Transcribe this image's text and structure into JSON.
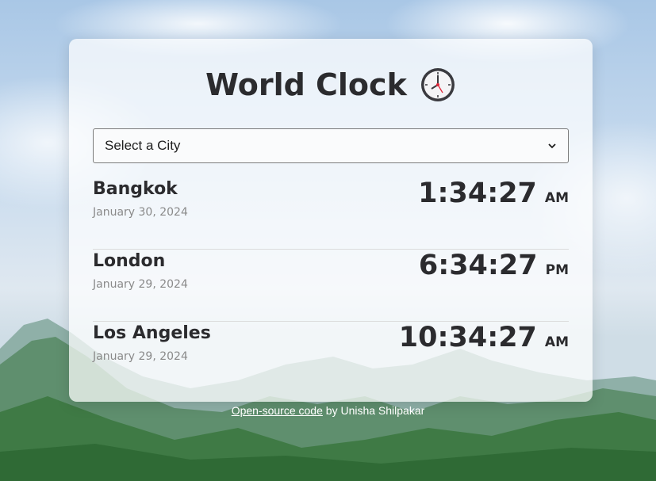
{
  "app": {
    "title": "World Clock"
  },
  "city_select": {
    "selected": "Select a City"
  },
  "cities": [
    {
      "name": "Bangkok",
      "date": "January 30, 2024",
      "time": "1:34:27",
      "period": "AM"
    },
    {
      "name": "London",
      "date": "January 29, 2024",
      "time": "6:34:27",
      "period": "PM"
    },
    {
      "name": "Los Angeles",
      "date": "January 29, 2024",
      "time": "10:34:27",
      "period": "AM"
    }
  ],
  "footer": {
    "link_text": "Open-source code",
    "byline": " by Unisha Shilpakar"
  },
  "colors": {
    "text": "#2b2b2e",
    "muted": "#8a8a8a",
    "clock_hand_red": "#e0263a"
  },
  "icons": {
    "title_icon": "clock-icon",
    "select_icon": "chevron-down-icon"
  }
}
